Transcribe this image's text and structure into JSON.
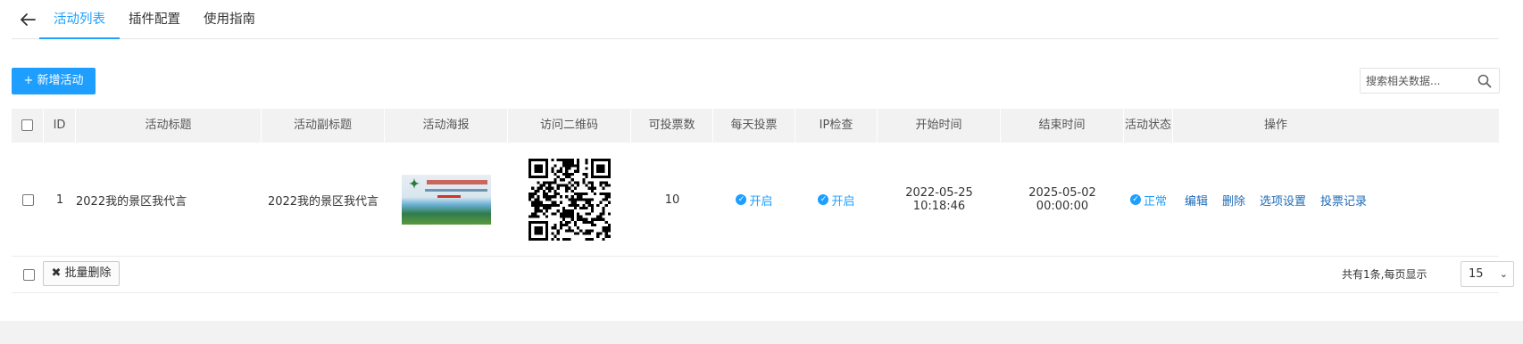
{
  "tabs": [
    {
      "label": "活动列表",
      "active": true
    },
    {
      "label": "插件配置",
      "active": false
    },
    {
      "label": "使用指南",
      "active": false
    }
  ],
  "toolbar": {
    "add_label": "+ 新增活动",
    "search_placeholder": "搜索相关数据..."
  },
  "table": {
    "headers": [
      "ID",
      "活动标题",
      "活动副标题",
      "活动海报",
      "访问二维码",
      "可投票数",
      "每天投票",
      "IP检查",
      "开始时间",
      "结束时间",
      "活动状态",
      "操作"
    ],
    "rows": [
      {
        "id": "1",
        "title": "2022我的景区我代言",
        "subtitle": "2022我的景区我代言",
        "votes": "10",
        "daily_vote": "开启",
        "ip_check": "开启",
        "start": "2022-05-25 10:18:46",
        "end": "2025-05-02 00:00:00",
        "status": "正常",
        "ops": [
          "编辑",
          "删除",
          "选项设置",
          "投票记录"
        ]
      }
    ]
  },
  "footer": {
    "batch_delete_label": "批量删除",
    "total_text": "共有1条,每页显示",
    "page_size": "15"
  },
  "colors": {
    "accent": "#1e9fff",
    "link": "#1e6bb8",
    "header_bg": "#f2f2f2"
  }
}
